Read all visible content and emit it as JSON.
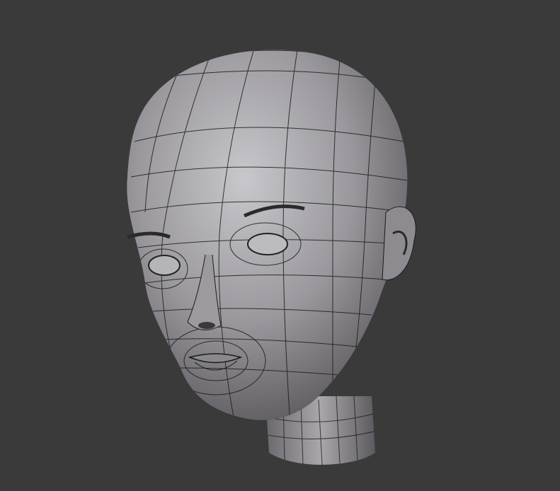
{
  "scene": {
    "subject": "head-mesh-wireframe",
    "colors": {
      "background": "#3a3a3a",
      "surface_light": "#c4c3c8",
      "surface_mid": "#8f8d92",
      "surface_dark": "#4e4c50",
      "wire": "#1a1a1a"
    }
  }
}
